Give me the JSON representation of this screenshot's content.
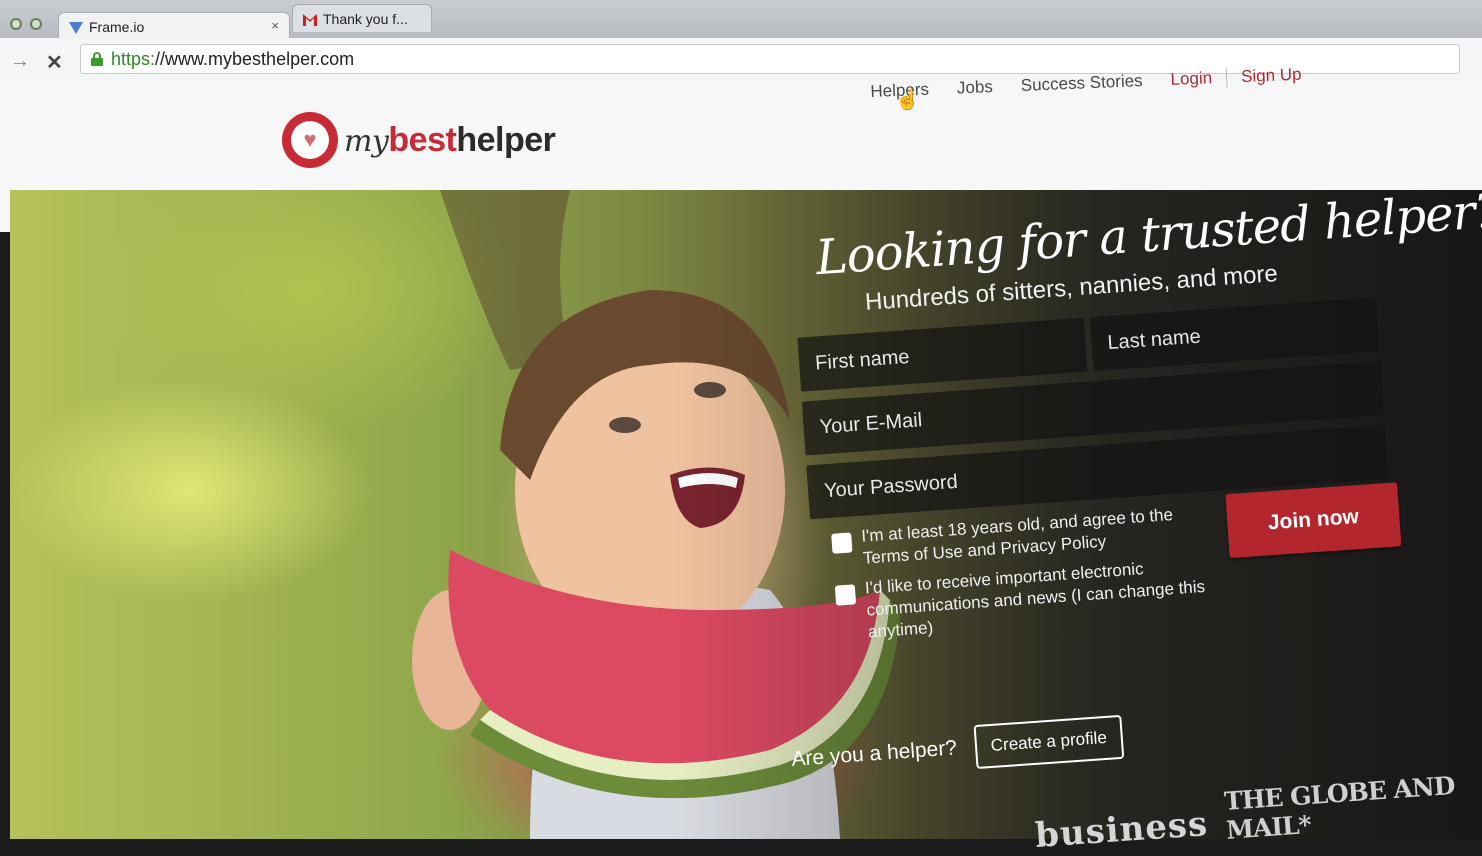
{
  "browser": {
    "tabs": [
      {
        "label": "Frame.io",
        "close": "×",
        "favicon": "frameio-favicon"
      },
      {
        "label": "Thank you f...",
        "favicon": "gmail-favicon"
      }
    ],
    "url_scheme": "https:",
    "url_rest": "//www.mybesthelper.com",
    "stop_glyph": "✕",
    "forward_glyph": "→"
  },
  "site": {
    "logo": {
      "my": "my",
      "best": "best",
      "helper": "helper"
    },
    "nav": {
      "helpers": "Helpers",
      "jobs": "Jobs",
      "success_stories": "Success Stories",
      "login": "Login",
      "signup": "Sign Up"
    }
  },
  "hero": {
    "title": "Looking for a trusted helper?",
    "subtitle": "Hundreds of sitters, nannies, and more",
    "form": {
      "first_name_placeholder": "First name",
      "last_name_placeholder": "Last name",
      "email_placeholder": "Your E-Mail",
      "password_placeholder": "Your Password",
      "terms_label": "I'm at least 18 years old, and agree to the Terms of Use and Privacy Policy",
      "news_label": "I'd like to receive important electronic communications and news (I can change this anytime)",
      "join_label": "Join now"
    },
    "helper_question": "Are you a helper?",
    "create_profile_label": "Create a profile",
    "press": [
      "business",
      "THE GLOBE AND MAIL*"
    ]
  },
  "colors": {
    "brand_red": "#c62b36",
    "join_button": "#b3262d",
    "field_bg": "#141414",
    "secure_green": "#2c8a25"
  }
}
